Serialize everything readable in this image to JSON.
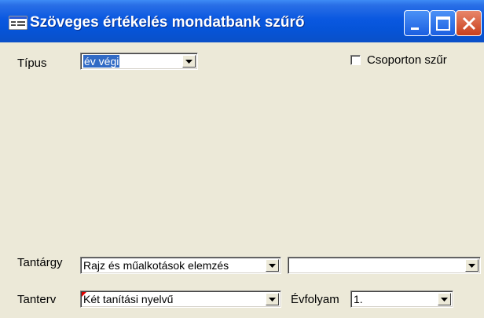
{
  "window": {
    "title": "Szöveges értékelés mondatbank szűrő",
    "accent_color": "#0a58e0",
    "controls": [
      "minimize-icon",
      "maximize-icon",
      "close-icon"
    ]
  },
  "filters": {
    "tipus": {
      "label": "Típus",
      "value": "év végi"
    },
    "csoporton": {
      "label": "Csoporton szűr",
      "checked": false
    },
    "tantargy": {
      "label": "Tantárgy",
      "value": "Rajz és műalkotások elemzés",
      "secondary_value": ""
    },
    "tanterv": {
      "label": "Tanterv",
      "value": "Két tanítási nyelvű"
    },
    "evfolyam": {
      "label": "Évfolyam",
      "value": "1."
    }
  }
}
